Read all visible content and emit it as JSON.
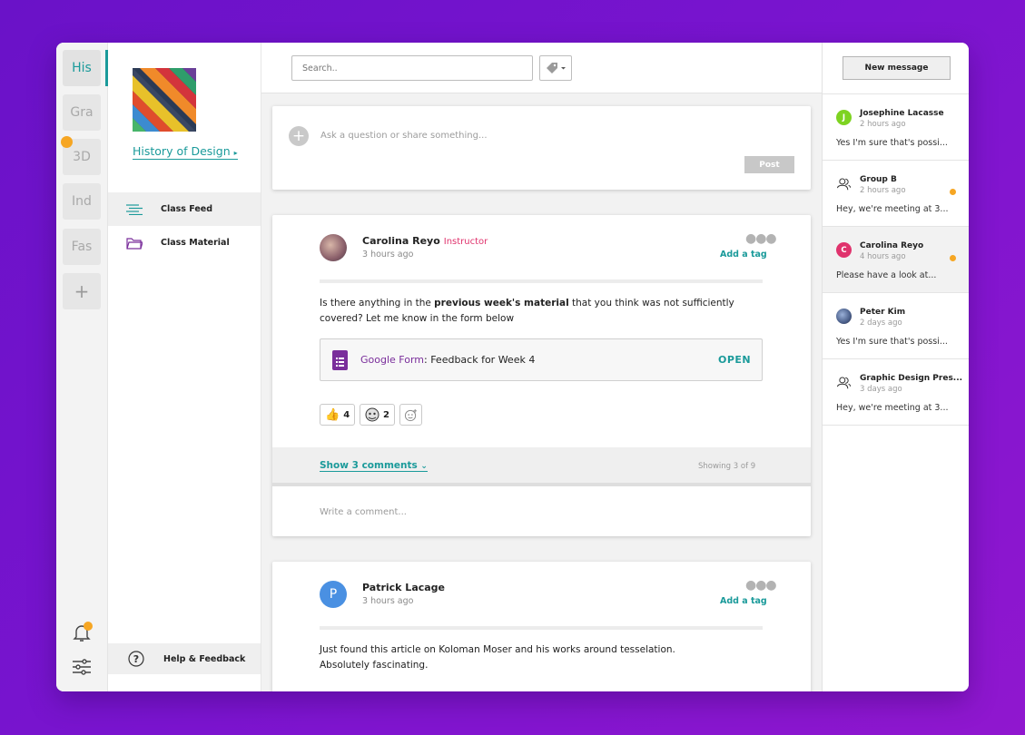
{
  "rail": {
    "courses": [
      "His",
      "Gra",
      "3D",
      "Ind",
      "Fas"
    ],
    "add_label": "+"
  },
  "course": {
    "title": "History of Design",
    "nav": [
      "Class Feed",
      "Class Material"
    ],
    "help": "Help & Feedback"
  },
  "feed": {
    "search_placeholder": "Search..",
    "ask_placeholder": "Ask a question or share something...",
    "post_label": "Post",
    "posts": [
      {
        "author": "Carolina Reyo",
        "role": "Instructor",
        "time": "3 hours ago",
        "add_tag": "Add a tag",
        "body_pre": "Is there anything in the ",
        "body_bold": "previous week's material",
        "body_post": " that you think was not sufficiently covered? Let me know in the form below",
        "attachment": {
          "source": "Google Form",
          "title": ": Feedback for Week 4",
          "action": "OPEN"
        },
        "reactions": [
          {
            "count": "4"
          },
          {
            "count": "2"
          }
        ],
        "show_comments": "Show 3 comments",
        "showing": "Showing 3 of 9",
        "write_comment": "Write a comment..."
      },
      {
        "author": "Patrick Lacage",
        "avatar_letter": "P",
        "time": "3 hours ago",
        "add_tag": "Add a tag",
        "body": "Just found this article on Koloman Moser and his works around tesselation. Absolutely fascinating."
      }
    ]
  },
  "messages": {
    "new_message": "New message",
    "items": [
      {
        "name": "Josephine Lacasse",
        "time": "2 hours ago",
        "preview": "Yes I'm sure that's possi...",
        "avatar_letter": "J"
      },
      {
        "name": "Group B",
        "time": "2 hours ago",
        "preview": "Hey, we're meeting at 3..."
      },
      {
        "name": "Carolina Reyo",
        "time": "4 hours ago",
        "preview": "Please have a look at...",
        "avatar_letter": "C"
      },
      {
        "name": "Peter Kim",
        "time": "2 days ago",
        "preview": "Yes I'm sure that's possi..."
      },
      {
        "name": "Graphic Design Pres...",
        "time": "3 days ago",
        "preview": "Hey, we're meeting at 3..."
      }
    ]
  },
  "colors": {
    "accent": "#1a9a9a",
    "badge": "#f6a623",
    "instructor": "#e0336d",
    "forms": "#7a2e9b"
  }
}
